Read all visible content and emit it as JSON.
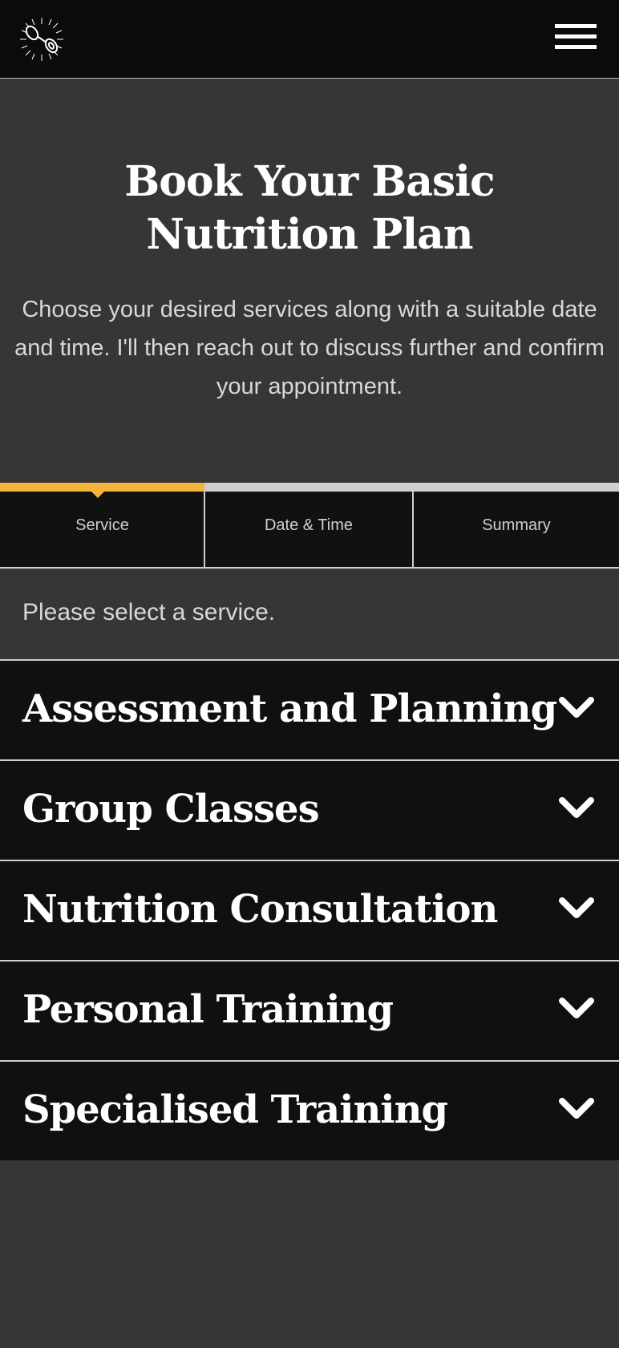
{
  "header": {
    "logo_icon": "dumbbell-logo-icon",
    "menu_icon": "hamburger-menu-icon"
  },
  "hero": {
    "title": "Book Your Basic Nutrition Plan",
    "subtitle": "Choose your desired services along with a suitable date and time. I'll then reach out to discuss further and confirm your appointment."
  },
  "steps": {
    "active_index": 0,
    "accent_color": "#f5b43a",
    "items": [
      {
        "label": "Service"
      },
      {
        "label": "Date & Time"
      },
      {
        "label": "Summary"
      }
    ]
  },
  "prompt": "Please select a service.",
  "services": {
    "expand_icon": "chevron-down-icon",
    "items": [
      {
        "name": "Assessment and Planning"
      },
      {
        "name": "Group Classes"
      },
      {
        "name": "Nutrition Consultation"
      },
      {
        "name": "Personal Training"
      },
      {
        "name": "Specialised Training"
      }
    ]
  }
}
